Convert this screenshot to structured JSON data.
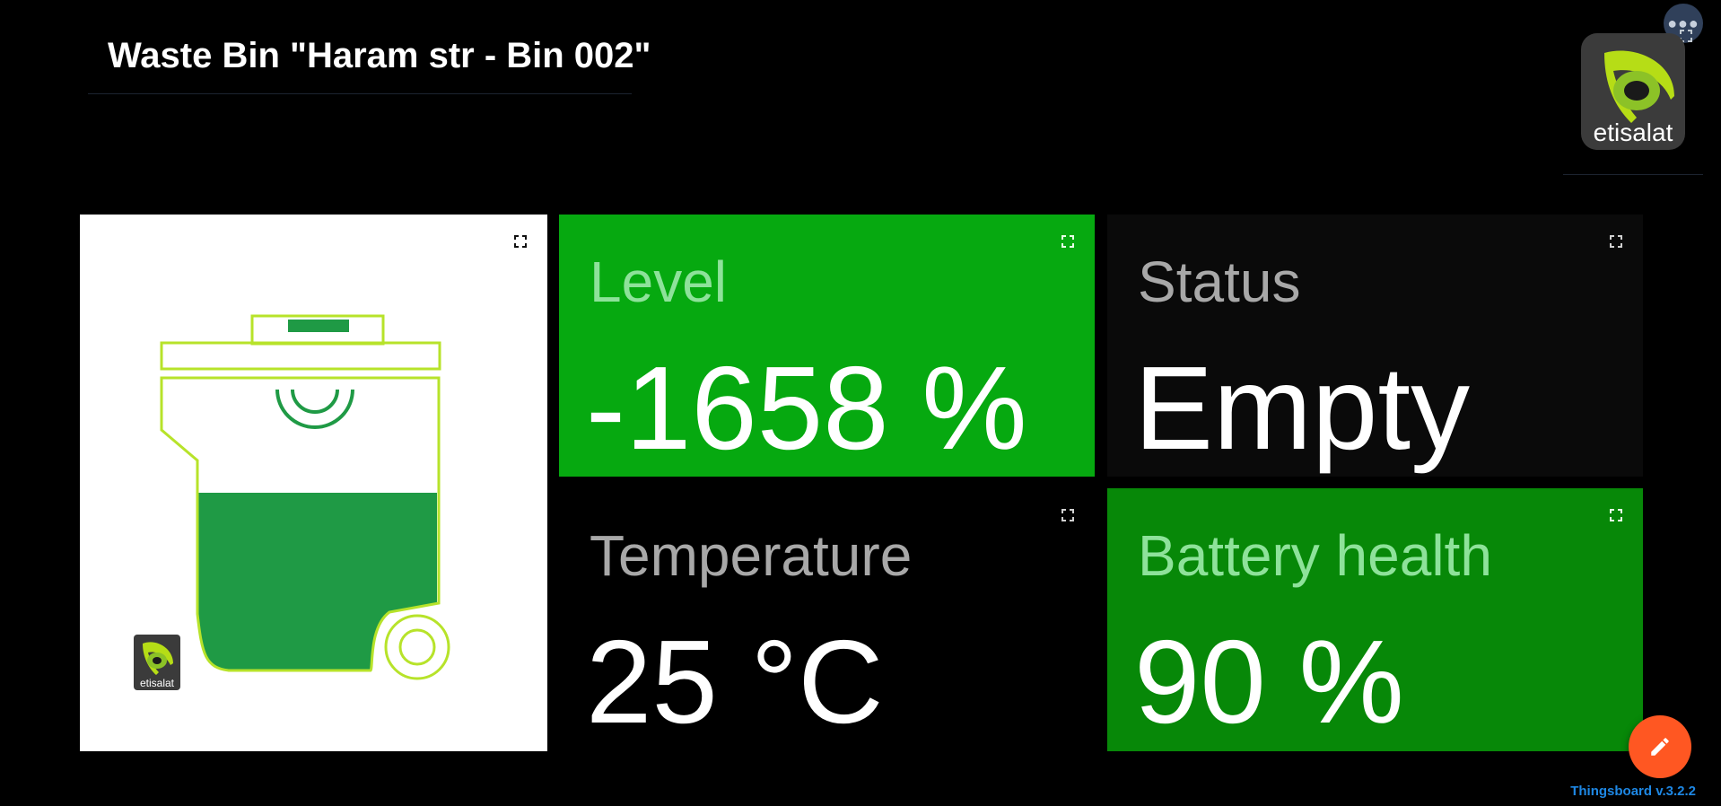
{
  "dashboard": {
    "title": "Waste Bin \"Haram str - Bin 002\"",
    "logo_text": "etisalat",
    "version": "Thingsboard v.3.2.2"
  },
  "widgets": {
    "bin_image": {
      "fill_level": 0.42,
      "logo_text": "etisalat"
    },
    "level": {
      "label": "Level",
      "value": "-1658 %",
      "background": "#06a910",
      "label_color": "#8ee29a"
    },
    "status": {
      "label": "Status",
      "value": "Empty",
      "background": "#0a0a0a",
      "label_color": "#a8a8a8"
    },
    "temperature": {
      "label": "Temperature",
      "value": "25 °C",
      "background": "#000000",
      "label_color": "#a8a8a8"
    },
    "battery": {
      "label": "Battery health",
      "value": "90 %",
      "background": "#078808",
      "label_color": "#8ee29a"
    }
  },
  "icons": {
    "menu": "more-horiz-icon",
    "expand": "fullscreen-icon",
    "edit": "pencil-icon"
  },
  "colors": {
    "accent_fab": "#ff5722",
    "bin_outline": "#b7e32a",
    "bin_fill": "#1f9a45",
    "version_link": "#1e88e5"
  }
}
